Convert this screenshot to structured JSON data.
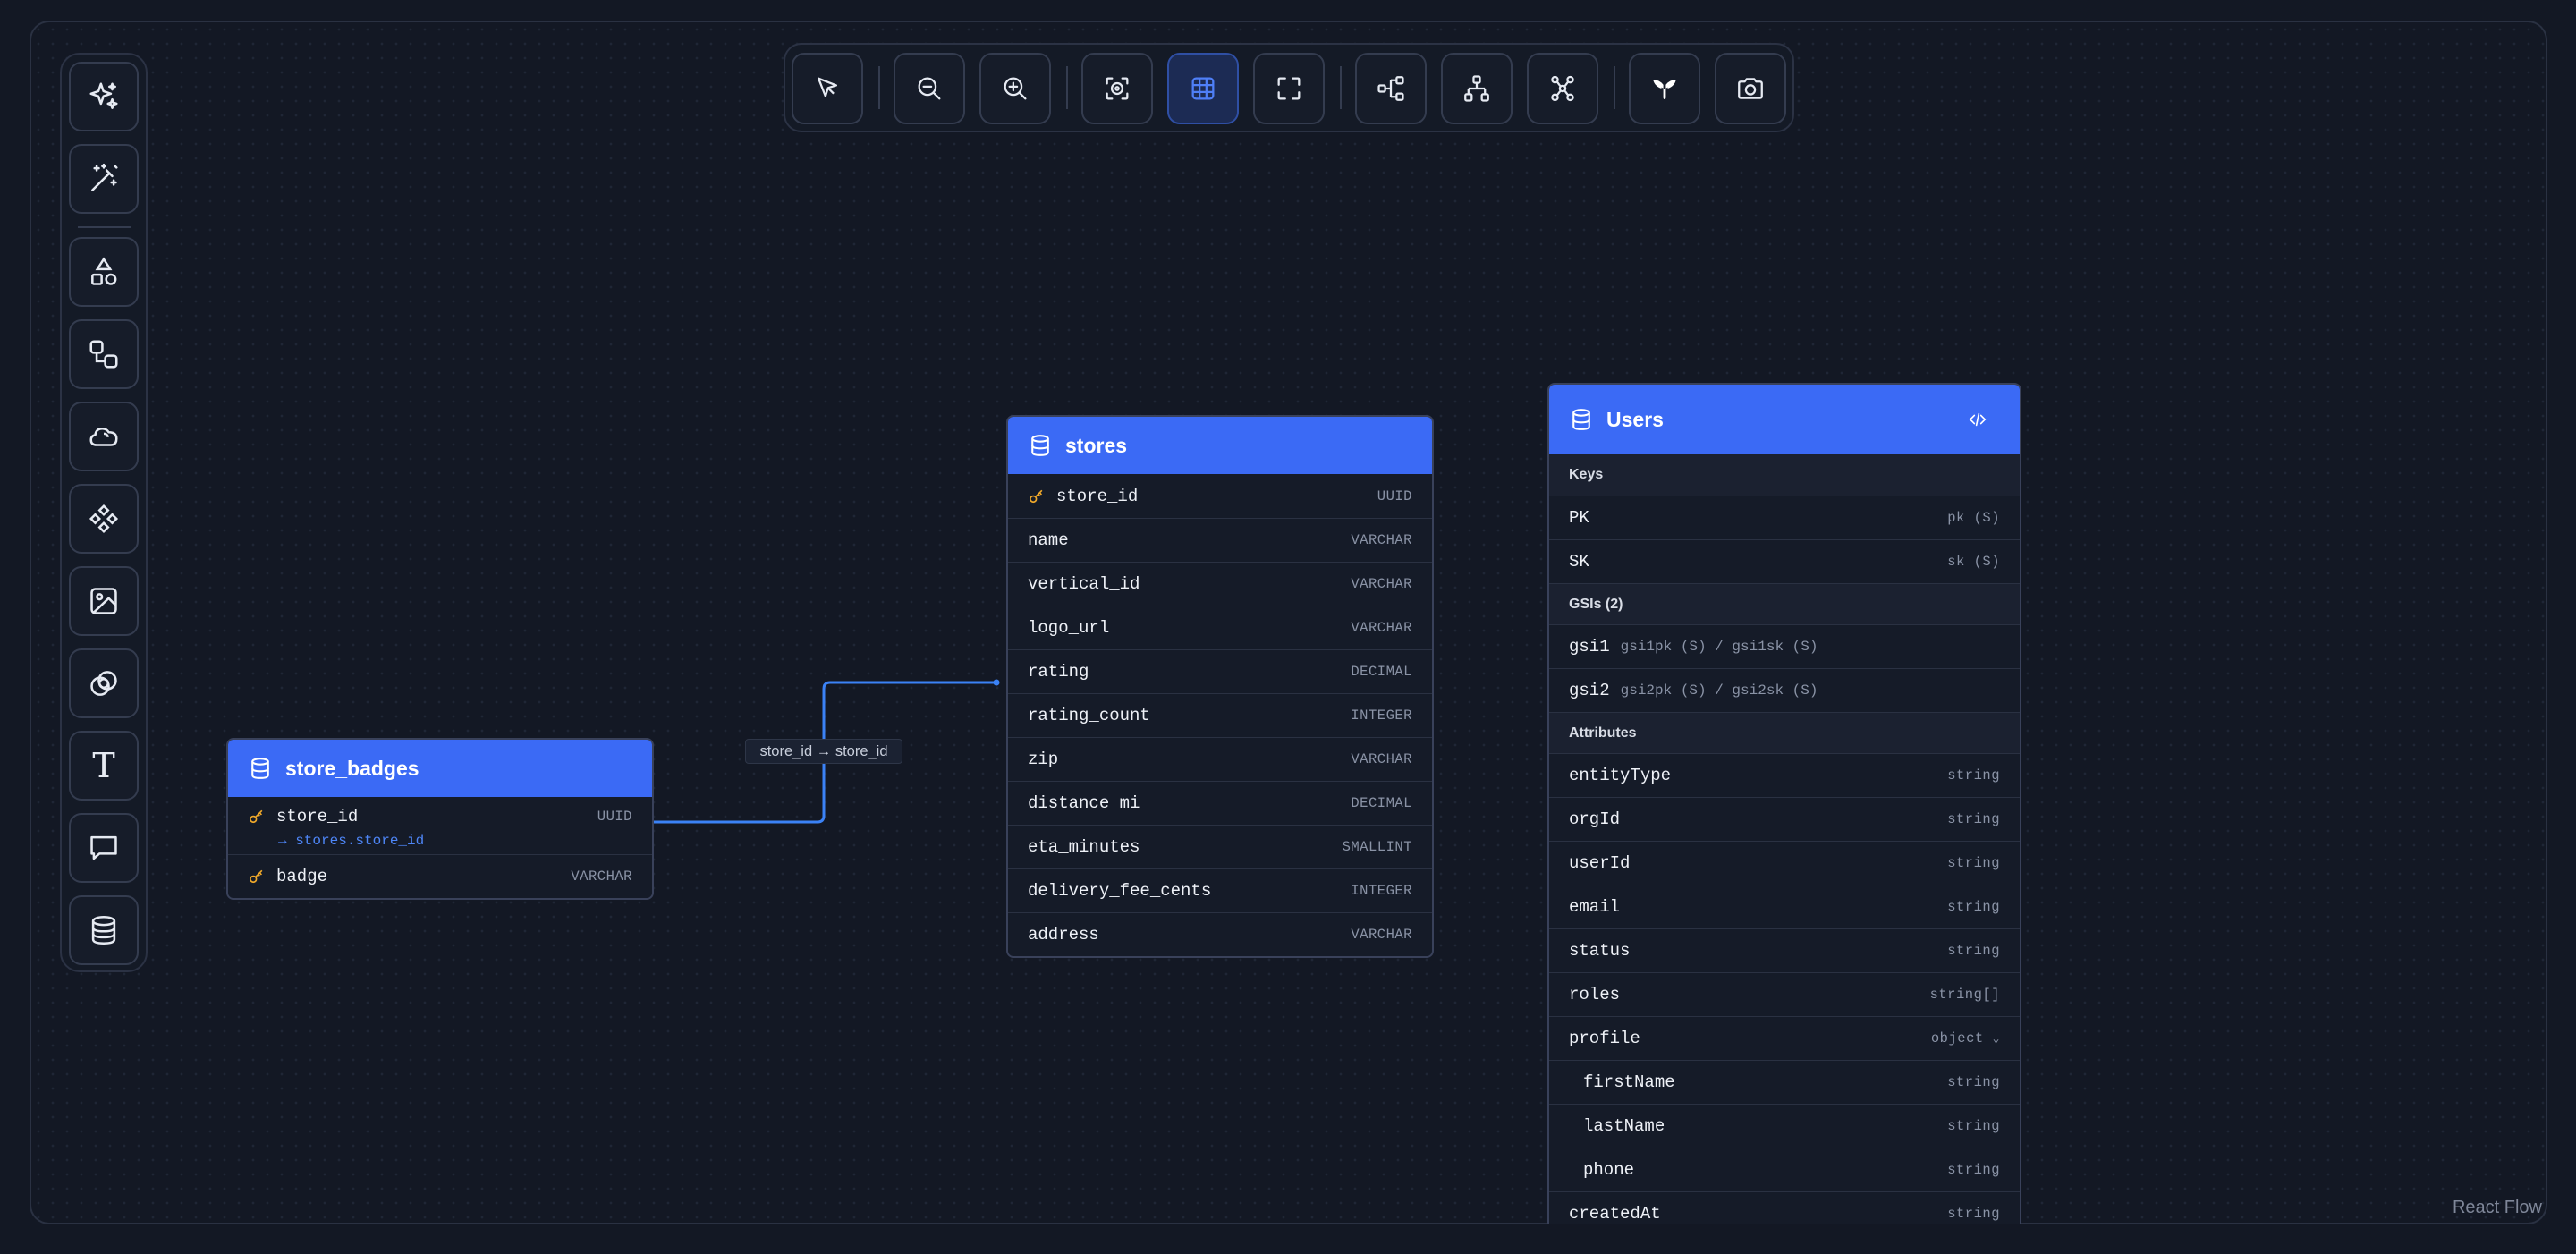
{
  "attribution": "React Flow",
  "edge": {
    "label": "store_id → store_id",
    "color": "#3b82f6"
  },
  "accent": "#3b6af5",
  "sidebar": {
    "tools": [
      {
        "icon": "sparkles-icon"
      },
      {
        "icon": "magic-wand-icon"
      },
      {
        "icon": "shapes-icon"
      },
      {
        "icon": "flow-blocks-icon"
      },
      {
        "icon": "cloud-icon"
      },
      {
        "icon": "components-icon"
      },
      {
        "icon": "image-icon"
      },
      {
        "icon": "rings-icon"
      },
      {
        "icon": "text-icon",
        "glyph": "T"
      },
      {
        "icon": "comment-icon"
      },
      {
        "icon": "database-icon"
      }
    ]
  },
  "toolbar": {
    "buttons": [
      {
        "icon": "pointer-icon"
      },
      {
        "icon": "zoom-out-icon"
      },
      {
        "icon": "zoom-in-icon"
      },
      {
        "icon": "focus-icon"
      },
      {
        "icon": "grid-icon",
        "active": true
      },
      {
        "icon": "fit-view-icon"
      },
      {
        "icon": "layout-horizontal-icon"
      },
      {
        "icon": "layout-tree-icon"
      },
      {
        "icon": "layout-graph-icon"
      },
      {
        "icon": "logo-icon"
      },
      {
        "icon": "camera-icon"
      }
    ]
  },
  "tables": {
    "store_badges": {
      "title": "store_badges",
      "rows": [
        {
          "name": "store_id",
          "type": "UUID",
          "key": true,
          "ref": "→ stores.store_id"
        },
        {
          "name": "badge",
          "type": "VARCHAR",
          "key": true
        }
      ]
    },
    "stores": {
      "title": "stores",
      "rows": [
        {
          "name": "store_id",
          "type": "UUID",
          "key": true
        },
        {
          "name": "name",
          "type": "VARCHAR"
        },
        {
          "name": "vertical_id",
          "type": "VARCHAR"
        },
        {
          "name": "logo_url",
          "type": "VARCHAR"
        },
        {
          "name": "rating",
          "type": "DECIMAL"
        },
        {
          "name": "rating_count",
          "type": "INTEGER"
        },
        {
          "name": "zip",
          "type": "VARCHAR"
        },
        {
          "name": "distance_mi",
          "type": "DECIMAL"
        },
        {
          "name": "eta_minutes",
          "type": "SMALLINT"
        },
        {
          "name": "delivery_fee_cents",
          "type": "INTEGER"
        },
        {
          "name": "address",
          "type": "VARCHAR"
        }
      ]
    },
    "users": {
      "title": "Users",
      "sections": {
        "keys": "Keys",
        "gsis": "GSIs (2)",
        "attributes": "Attributes"
      },
      "keys": [
        {
          "name": "PK",
          "type": "pk (S)"
        },
        {
          "name": "SK",
          "type": "sk (S)"
        }
      ],
      "gsis": [
        {
          "name": "gsi1",
          "detail": "gsi1pk (S) / gsi1sk (S)"
        },
        {
          "name": "gsi2",
          "detail": "gsi2pk (S) / gsi2sk (S)"
        }
      ],
      "attributes": [
        {
          "name": "entityType",
          "type": "string"
        },
        {
          "name": "orgId",
          "type": "string"
        },
        {
          "name": "userId",
          "type": "string"
        },
        {
          "name": "email",
          "type": "string"
        },
        {
          "name": "status",
          "type": "string"
        },
        {
          "name": "roles",
          "type": "string[]"
        },
        {
          "name": "profile",
          "type": "object",
          "expandable": true
        },
        {
          "name": "firstName",
          "type": "string",
          "nested": true
        },
        {
          "name": "lastName",
          "type": "string",
          "nested": true
        },
        {
          "name": "phone",
          "type": "string",
          "nested": true
        },
        {
          "name": "createdAt",
          "type": "string"
        }
      ]
    }
  }
}
